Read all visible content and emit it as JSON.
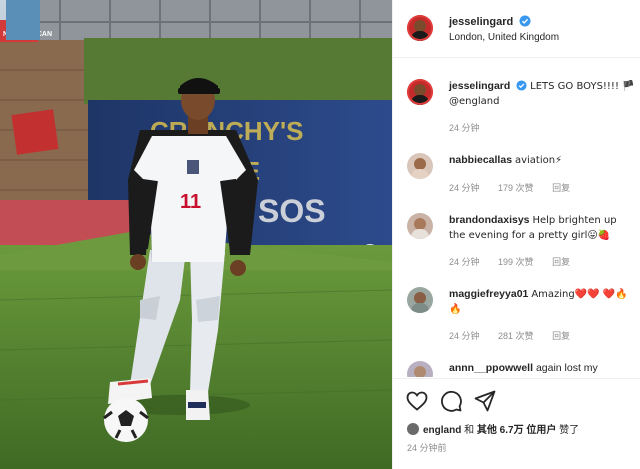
{
  "post": {
    "author": "jesselingard",
    "location": "London, United Kingdom",
    "caption": {
      "text": "LETS GO BOYS!!!! 🏴 @england",
      "time": "24 分钟"
    },
    "comments": [
      {
        "user": "nabbiecallas",
        "text": "aviation⚡",
        "time": "24 分钟",
        "likes": "179 次赞",
        "reply": "回复"
      },
      {
        "user": "brandondaxisys",
        "text": "Help brighten up the evening for a pretty girl😛🍓",
        "time": "24 分钟",
        "likes": "199 次赞",
        "reply": "回复"
      },
      {
        "user": "maggiefreyya01",
        "text": "Amazing❤️❤️ ❤️🔥🔥",
        "time": "24 分钟",
        "likes": "281 次赞",
        "reply": "回复"
      },
      {
        "user": "annn__ppowwell",
        "text": "again lost my",
        "time": "",
        "likes": "",
        "reply": ""
      }
    ],
    "likes_line": {
      "user": "england",
      "mid": "和",
      "others": "其他 6.7万 位用户",
      "suffix": "赞了"
    },
    "timestamp": "24 分钟前",
    "photo": {
      "sign_text": "NEW PELICAN",
      "banner_text": "CRUNCHY'S ULTIMATE SHOOTOUT",
      "jersey_number": "11"
    }
  },
  "colors": {
    "verified": "#3897f0",
    "muted": "#8e8e8e",
    "grass": "#4f7a2e",
    "heart": "#ed4956"
  },
  "icons": {
    "like": "heart-icon",
    "comment": "comment-bubble-icon",
    "share": "paper-plane-icon"
  }
}
